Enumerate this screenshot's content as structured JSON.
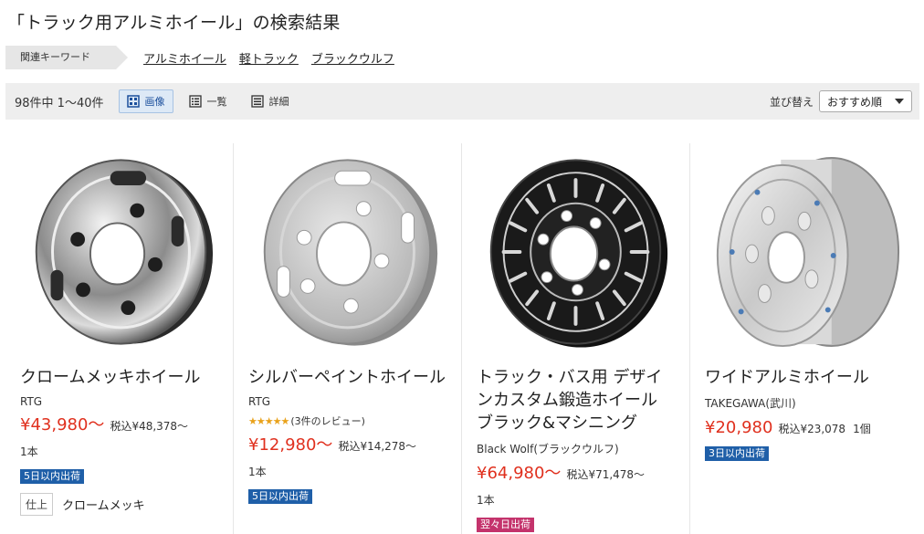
{
  "page": {
    "title": "「トラック用アルミホイール」の検索結果"
  },
  "keywords": {
    "label": "関連キーワード",
    "items": [
      "アルミホイール",
      "軽トラック",
      "ブラックウルフ"
    ]
  },
  "toolbar": {
    "count": "98件中 1〜40件",
    "views": [
      "画像",
      "一覧",
      "詳細"
    ],
    "active_view": "画像",
    "sort_label": "並び替え",
    "sort_value": "おすすめ順"
  },
  "products": [
    {
      "name": "クロームメッキホイール",
      "maker": "RTG",
      "price": "¥43,980〜",
      "tax_price": "税込¥48,378〜",
      "unit": "1本",
      "shipping": "5日以内出荷",
      "finish_label": "仕上",
      "finish_value": "クロームメッキ"
    },
    {
      "name": "シルバーペイントホイール",
      "maker": "RTG",
      "rating_text": "(3件のレビュー)",
      "rating_value": 4.5,
      "price": "¥12,980〜",
      "tax_price": "税込¥14,278〜",
      "unit": "1本",
      "shipping": "5日以内出荷"
    },
    {
      "name": "トラック・バス用 デザインカスタム鍛造ホイール ブラック&マシニング",
      "maker": "Black Wolf(ブラックウルフ)",
      "price": "¥64,980〜",
      "tax_price": "税込¥71,478〜",
      "unit": "1本",
      "shipping": "翌々日出荷"
    },
    {
      "name": "ワイドアルミホイール",
      "maker": "TAKEGAWA(武川)",
      "price": "¥20,980",
      "tax_price": "税込¥23,078",
      "unit": "1個",
      "shipping": "3日以内出荷"
    }
  ],
  "colors": {
    "price": "#e0301e",
    "badge_blue": "#1f5fa8",
    "badge_pink": "#c4336c",
    "active_view": "#dde9f6"
  }
}
